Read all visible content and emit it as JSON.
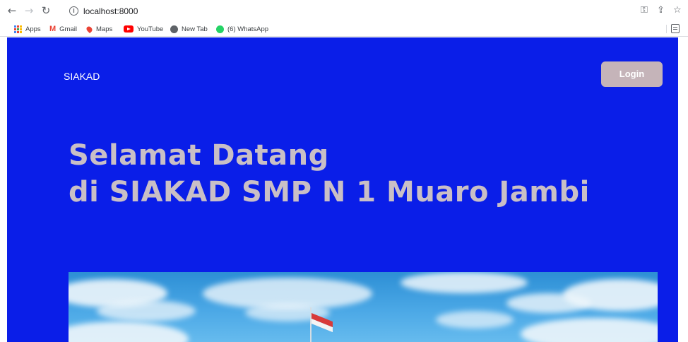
{
  "browser": {
    "url": "localhost:8000",
    "bookmarks": [
      {
        "label": "Apps",
        "icon": "apps-grid-icon"
      },
      {
        "label": "Gmail",
        "icon": "gmail-icon"
      },
      {
        "label": "Maps",
        "icon": "maps-icon"
      },
      {
        "label": "YouTube",
        "icon": "youtube-icon"
      },
      {
        "label": "New Tab",
        "icon": "globe-icon"
      },
      {
        "label": "(6) WhatsApp",
        "icon": "whatsapp-icon"
      }
    ]
  },
  "page": {
    "brand": "SIAKAD",
    "login_label": "Login",
    "title_line1": "Selamat Datang",
    "title_line2": "di SIAKAD SMP N 1 Muaro Jambi",
    "colors": {
      "hero_bg": "#0a1ee8",
      "title": "#c9bfc6",
      "login_bg": "#c5b4b9"
    }
  }
}
